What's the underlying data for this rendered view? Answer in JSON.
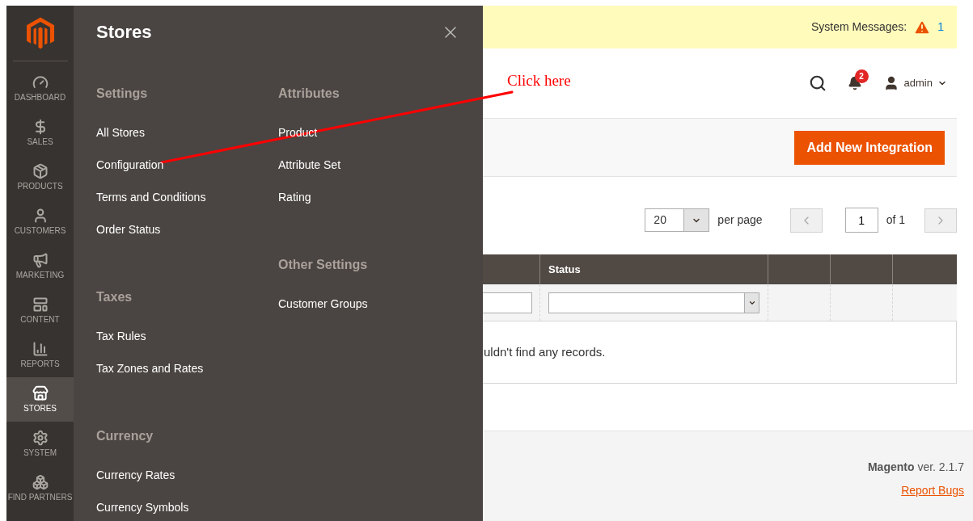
{
  "sidebar": {
    "items": [
      {
        "label": "DASHBOARD",
        "selected": false
      },
      {
        "label": "SALES",
        "selected": false
      },
      {
        "label": "PRODUCTS",
        "selected": false
      },
      {
        "label": "CUSTOMERS",
        "selected": false
      },
      {
        "label": "MARKETING",
        "selected": false
      },
      {
        "label": "CONTENT",
        "selected": false
      },
      {
        "label": "REPORTS",
        "selected": false
      },
      {
        "label": "STORES",
        "selected": true
      },
      {
        "label": "SYSTEM",
        "selected": false
      },
      {
        "label": "FIND PARTNERS",
        "selected": false
      }
    ]
  },
  "flyout": {
    "title": "Stores",
    "columns": [
      [
        {
          "heading": "Settings",
          "links": [
            "All Stores",
            "Configuration",
            "Terms and Conditions",
            "Order Status"
          ]
        },
        {
          "heading": "Taxes",
          "links": [
            "Tax Rules",
            "Tax Zones and Rates"
          ]
        },
        {
          "heading": "Currency",
          "links": [
            "Currency Rates",
            "Currency Symbols"
          ]
        }
      ],
      [
        {
          "heading": "Attributes",
          "links": [
            "Product",
            "Attribute Set",
            "Rating"
          ]
        },
        {
          "heading": "Other Settings",
          "links": [
            "Customer Groups"
          ]
        }
      ]
    ]
  },
  "annotation": {
    "text": "Click here"
  },
  "system_messages": {
    "label": "System Messages:",
    "count": "1"
  },
  "header": {
    "notifications": "2",
    "user": "admin"
  },
  "actions": {
    "button": "Add New Integration"
  },
  "pager": {
    "per_page": "20",
    "per_page_label": "per page",
    "page": "1",
    "of": "of 1"
  },
  "table": {
    "status_heading": "Status",
    "empty_message": "uldn't find any records."
  },
  "footer": {
    "version": "**Magento** ver. 2.1.7",
    "link": "Report Bugs"
  }
}
